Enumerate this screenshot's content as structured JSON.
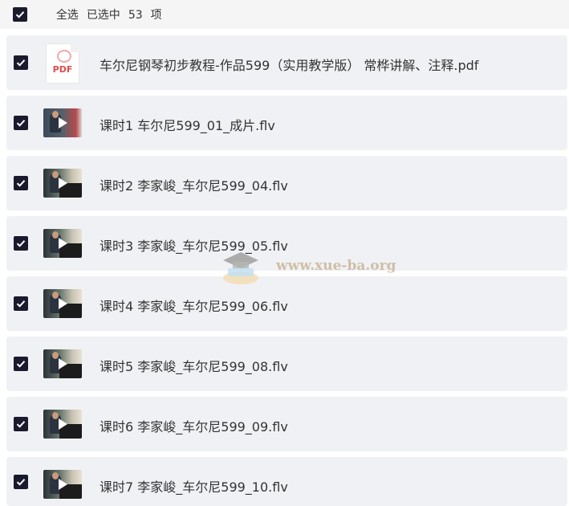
{
  "header": {
    "select_all": "全选",
    "selected_prefix": "已选中",
    "selected_count": "53",
    "selected_suffix": "项"
  },
  "files": [
    {
      "name": "车尔尼钢琴初步教程-作品599（实用教学版） 常桦讲解、注释.pdf",
      "type": "pdf",
      "icon_label": "PDF"
    },
    {
      "name": "课时1 车尔尼599_01_成片.flv",
      "type": "video"
    },
    {
      "name": "课时2 李家峻_车尔尼599_04.flv",
      "type": "video"
    },
    {
      "name": "课时3 李家峻_车尔尼599_05.flv",
      "type": "video"
    },
    {
      "name": "课时4 李家峻_车尔尼599_06.flv",
      "type": "video"
    },
    {
      "name": "课时5 李家峻_车尔尼599_08.flv",
      "type": "video"
    },
    {
      "name": "课时6 李家峻_车尔尼599_09.flv",
      "type": "video"
    },
    {
      "name": "课时7 李家峻_车尔尼599_10.flv",
      "type": "video"
    }
  ],
  "watermark": {
    "text": "www.xue-ba.org"
  },
  "colors": {
    "checkbox": "#1a1a2e",
    "row_bg": "#f0f1f4",
    "pdf_red": "#e24b4b"
  }
}
